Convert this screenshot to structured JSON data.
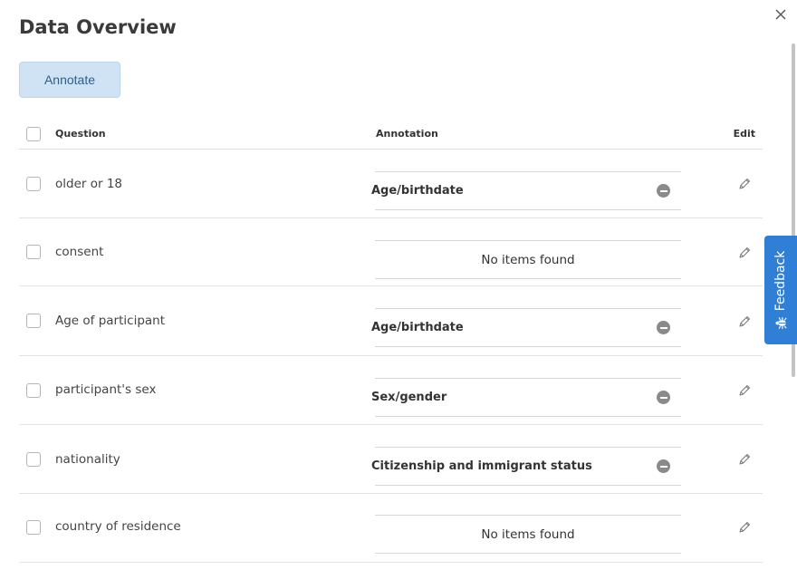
{
  "dialog": {
    "title": "Data Overview",
    "annotate_label": "Annotate"
  },
  "table": {
    "headers": {
      "question": "Question",
      "annotation": "Annotation",
      "edit": "Edit"
    },
    "rows": [
      {
        "question": "older or 18",
        "annotation": "Age/birthdate"
      },
      {
        "question": "consent",
        "annotation": "No items found"
      },
      {
        "question": "Age of participant",
        "annotation": "Age/birthdate"
      },
      {
        "question": "participant's sex",
        "annotation": "Sex/gender"
      },
      {
        "question": "nationality",
        "annotation": "Citizenship and immigrant status"
      },
      {
        "question": "country of residence",
        "annotation": "No items found"
      }
    ]
  },
  "feedback": {
    "label": "Feedback"
  },
  "icons": {
    "close": "close-icon",
    "edit": "pencil-icon",
    "remove": "minus-circle-icon",
    "bug": "bug-icon"
  },
  "colors": {
    "annotate_bg": "#cfe3f5",
    "annotate_text": "#2c5f8f",
    "feedback_bg": "#2f7fd6",
    "remove_icon": "#8a8a8a"
  }
}
